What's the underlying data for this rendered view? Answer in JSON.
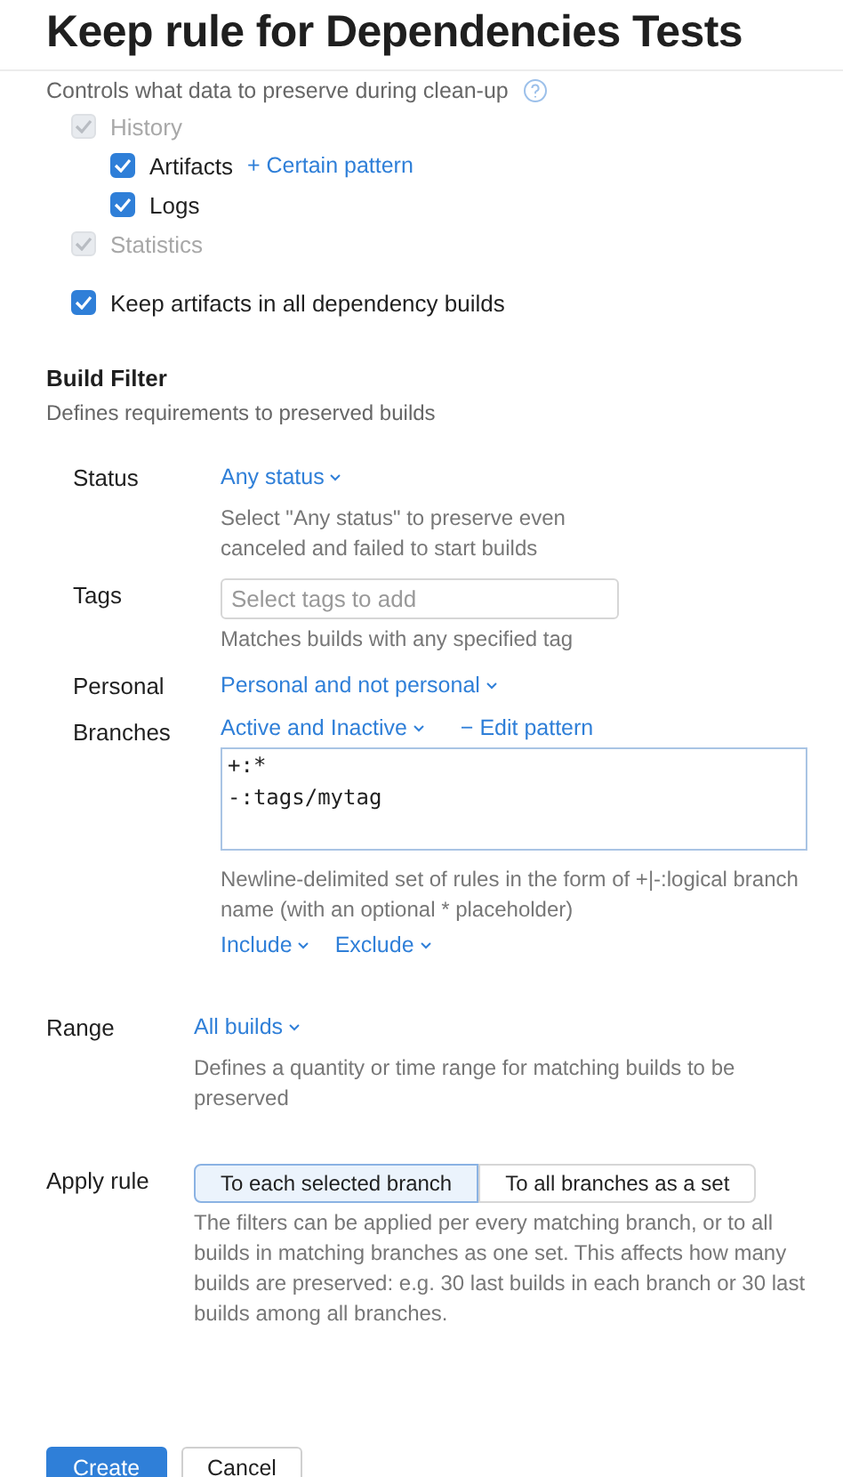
{
  "title": "Keep rule for Dependencies Tests",
  "subtitle": "Controls what data to preserve during clean-up",
  "preserve_items": [
    {
      "label": "History",
      "checked": true,
      "disabled": true,
      "children": [
        {
          "label": "Artifacts",
          "checked": true,
          "disabled": false,
          "link": "+ Certain pattern"
        },
        {
          "label": "Logs",
          "checked": true,
          "disabled": false
        }
      ]
    },
    {
      "label": "Statistics",
      "checked": true,
      "disabled": true
    }
  ],
  "dependency_option": {
    "label": "Keep artifacts in all dependency builds",
    "checked": true
  },
  "build_filter": {
    "heading": "Build Filter",
    "description": "Defines requirements to preserved builds",
    "status": {
      "label": "Status",
      "value": "Any status",
      "help": "Select \"Any status\" to preserve even canceled and failed to start builds"
    },
    "tags": {
      "label": "Tags",
      "placeholder": "Select tags to add",
      "help": "Matches builds with any specified tag"
    },
    "personal": {
      "label": "Personal",
      "value": "Personal and not personal"
    },
    "branches": {
      "label": "Branches",
      "value": "Active and Inactive",
      "edit_link": "− Edit pattern",
      "pattern": "+:*\n-:tags/mytag",
      "help": "Newline-delimited set of rules in the form of +|-:logical branch name (with an optional * placeholder)",
      "menus": [
        "Include",
        "Exclude"
      ]
    }
  },
  "range": {
    "label": "Range",
    "value": "All builds",
    "help": "Defines a quantity or time range for matching builds to be preserved"
  },
  "apply_rule": {
    "label": "Apply rule",
    "options": [
      {
        "label": "To each selected branch",
        "selected": true
      },
      {
        "label": "To all branches as a set",
        "selected": false
      }
    ],
    "help": "The filters can be applied per every matching branch, or to all builds in matching branches as one set. This affects how many builds are preserved: e.g. 30 last builds in each branch or 30 last builds among all branches."
  },
  "buttons": [
    {
      "label": "Create",
      "kind": "primary"
    },
    {
      "label": "Cancel",
      "kind": "secondary"
    }
  ]
}
